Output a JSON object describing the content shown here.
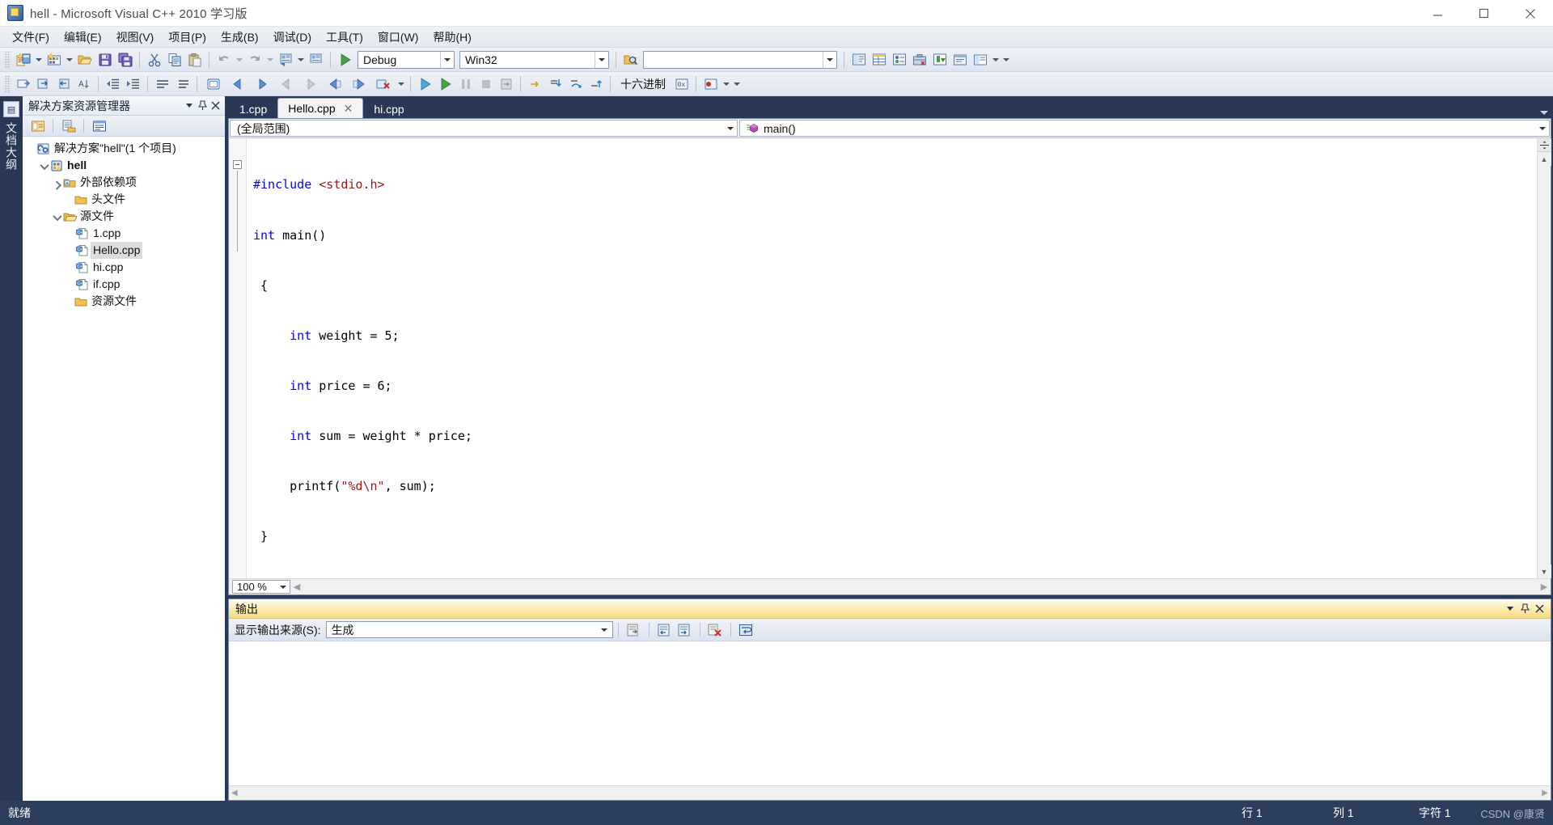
{
  "window": {
    "title": "hell - Microsoft Visual C++ 2010 学习版",
    "app_icon": "visual-studio-icon",
    "minimize": "—",
    "maximize": "❐",
    "close": "✕"
  },
  "menubar": {
    "items": [
      {
        "label": "文件(F)"
      },
      {
        "label": "编辑(E)"
      },
      {
        "label": "视图(V)"
      },
      {
        "label": "项目(P)"
      },
      {
        "label": "生成(B)"
      },
      {
        "label": "调试(D)"
      },
      {
        "label": "工具(T)"
      },
      {
        "label": "窗口(W)"
      },
      {
        "label": "帮助(H)"
      }
    ]
  },
  "toolbar_standard": {
    "new_project_icon": "new-project-icon",
    "add_item_icon": "add-new-item-icon",
    "open_icon": "open-file-icon",
    "save_icon": "save-icon",
    "save_all_icon": "save-all-icon",
    "cut_icon": "cut-icon",
    "copy_icon": "copy-icon",
    "paste_icon": "paste-icon",
    "undo_icon": "undo-icon",
    "redo_icon": "redo-icon",
    "navigate_icon": "navigate-backward-icon",
    "start_debug_icon": "start-debugging-icon",
    "config_value": "Debug",
    "platform_value": "Win32",
    "find_placeholder": "",
    "find_value": "",
    "solution_explorer_icon": "solution-explorer-icon",
    "properties_icon": "properties-window-icon",
    "object_browser_icon": "object-browser-icon",
    "toolbox_icon": "toolbox-icon",
    "error_list_icon": "error-list-icon",
    "output_icon": "output-window-icon",
    "overflow_icon": "toolbar-overflow-icon"
  },
  "toolbar_text_editor": {
    "items": [
      "comment-selection-icon",
      "uncomment-selection-icon",
      "decrease-indent-icon",
      "increase-indent-icon",
      "toggle-bookmark-icon",
      "prev-bookmark-icon",
      "next-bookmark-icon",
      "clear-bookmarks-icon",
      "step-into-icon",
      "step-over-icon",
      "step-out-icon"
    ],
    "hex_display_label": "十六进制",
    "hex_icon": "hexadecimal-display-icon",
    "breakpoint_icon": "breakpoint-icon",
    "watch_icon": "watch-window-icon"
  },
  "left_dock": {
    "icon": "toolbox-dock-icon",
    "label": "文档大纲"
  },
  "solution_explorer": {
    "title": "解决方案资源管理器",
    "pin_icon": "pin-icon",
    "close_icon": "close-icon",
    "dropdown_icon": "chevron-down-icon",
    "toolbar": {
      "properties_icon": "properties-icon",
      "show_all_files_icon": "show-all-files-icon",
      "view_code_icon": "view-code-icon"
    },
    "tree": [
      {
        "label": "解决方案\"hell\"(1 个项目)",
        "indent": 0,
        "twisty": "none",
        "icon": "solution-icon",
        "bold": false,
        "selected": false
      },
      {
        "label": "hell",
        "indent": 1,
        "twisty": "down",
        "icon": "project-icon",
        "bold": true,
        "selected": false
      },
      {
        "label": "外部依赖项",
        "indent": 2,
        "twisty": "right",
        "icon": "external-dependencies-icon",
        "bold": false,
        "selected": false
      },
      {
        "label": "头文件",
        "indent": 2,
        "twisty": "none",
        "icon": "folder-closed-icon",
        "bold": false,
        "selected": false
      },
      {
        "label": "源文件",
        "indent": 2,
        "twisty": "down",
        "icon": "folder-open-icon",
        "bold": false,
        "selected": false
      },
      {
        "label": "1.cpp",
        "indent": 3,
        "twisty": "none",
        "icon": "cpp-file-icon",
        "bold": false,
        "selected": false
      },
      {
        "label": "Hello.cpp",
        "indent": 3,
        "twisty": "none",
        "icon": "cpp-file-icon",
        "bold": false,
        "selected": true
      },
      {
        "label": "hi.cpp",
        "indent": 3,
        "twisty": "none",
        "icon": "cpp-file-icon",
        "bold": false,
        "selected": false
      },
      {
        "label": "if.cpp",
        "indent": 3,
        "twisty": "none",
        "icon": "cpp-file-icon",
        "bold": false,
        "selected": false
      },
      {
        "label": "资源文件",
        "indent": 2,
        "twisty": "none",
        "icon": "folder-closed-icon",
        "bold": false,
        "selected": false
      }
    ]
  },
  "editor": {
    "tabs": [
      {
        "label": "1.cpp",
        "active": false,
        "closable": false
      },
      {
        "label": "Hello.cpp",
        "active": true,
        "closable": true
      },
      {
        "label": "hi.cpp",
        "active": false,
        "closable": false
      }
    ],
    "tab_close_glyph": "✕",
    "tabstrip_dropdown_icon": "chevron-down-icon",
    "nav_scope": "(全局范围)",
    "nav_member": "main()",
    "nav_member_icon": "method-icon",
    "zoom_level": "100 %",
    "split_icon": "split-view-icon",
    "code_lines": [
      {
        "segments": [
          {
            "t": "    ",
            "c": ""
          },
          {
            "t": "#include",
            "c": "pre"
          },
          {
            "t": " ",
            "c": ""
          },
          {
            "t": "<stdio.h>",
            "c": "inc"
          }
        ]
      },
      {
        "segments": [
          {
            "t": "  ",
            "c": ""
          },
          {
            "t": "int",
            "c": "kw"
          },
          {
            "t": " main()",
            "c": ""
          }
        ]
      },
      {
        "segments": [
          {
            "t": "   {",
            "c": ""
          }
        ]
      },
      {
        "segments": [
          {
            "t": "       ",
            "c": ""
          },
          {
            "t": "int",
            "c": "kw"
          },
          {
            "t": " weight = 5;",
            "c": ""
          }
        ]
      },
      {
        "segments": [
          {
            "t": "       ",
            "c": ""
          },
          {
            "t": "int",
            "c": "kw"
          },
          {
            "t": " price = 6;",
            "c": ""
          }
        ]
      },
      {
        "segments": [
          {
            "t": "       ",
            "c": ""
          },
          {
            "t": "int",
            "c": "kw"
          },
          {
            "t": " sum = weight * price;",
            "c": ""
          }
        ]
      },
      {
        "segments": [
          {
            "t": "       printf(",
            "c": ""
          },
          {
            "t": "\"%d\\n\"",
            "c": "str"
          },
          {
            "t": ", sum);",
            "c": ""
          }
        ]
      },
      {
        "segments": [
          {
            "t": "   }",
            "c": ""
          }
        ]
      }
    ]
  },
  "output": {
    "title": "输出",
    "dropdown_icon": "chevron-down-icon",
    "pin_icon": "pin-icon",
    "close_icon": "close-icon",
    "source_label": "显示输出来源(S):",
    "source_value": "生成",
    "toolbar_icons": [
      "find-message-icon",
      "go-to-previous-message-icon",
      "go-to-next-message-icon",
      "clear-all-icon",
      "toggle-word-wrap-icon"
    ],
    "body_text": ""
  },
  "statusbar": {
    "ready": "就绪",
    "line_label": "行 1",
    "column_label": "列 1",
    "char_label": "字符 1",
    "watermark": "CSDN @康贤"
  },
  "colors": {
    "chrome_dark": "#293955",
    "statusbar": "#2d3e5c",
    "output_header": "#fbe9a8",
    "keyword_blue": "#0000ff",
    "string_red": "#a31515",
    "selection_gray": "#dcdcdc"
  }
}
